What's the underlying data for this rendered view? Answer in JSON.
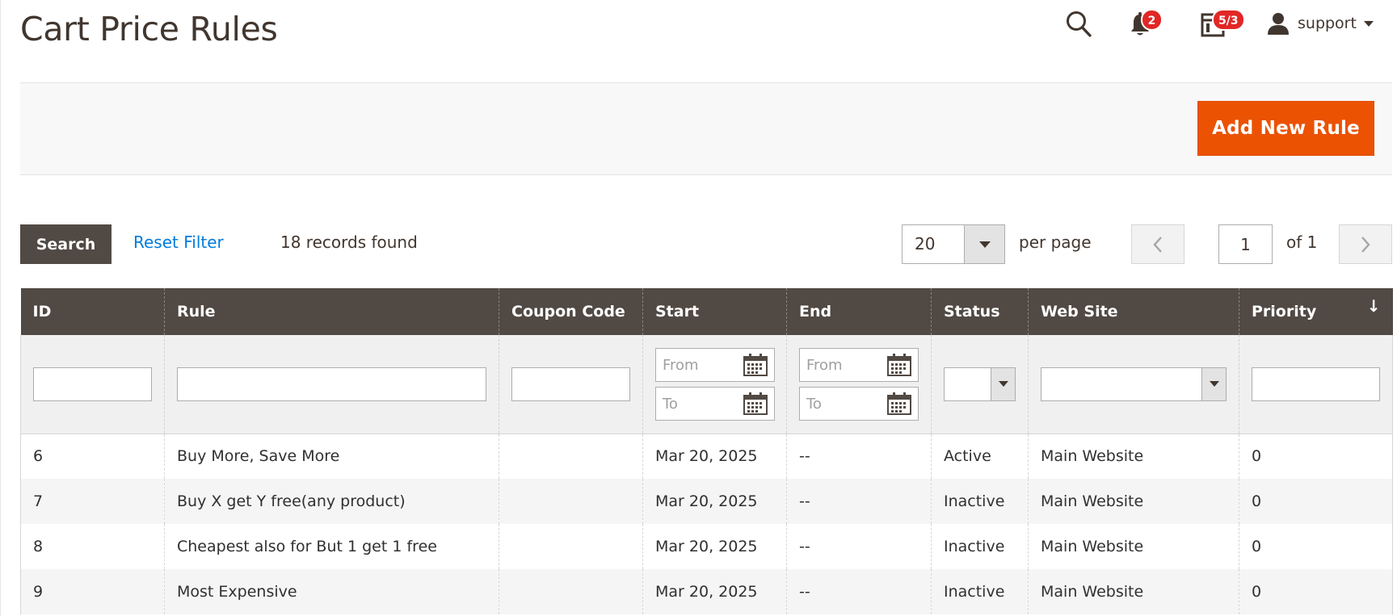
{
  "header": {
    "title": "Cart Price Rules",
    "notifications_count": "2",
    "system_messages_count": "5/3",
    "user_name": "support"
  },
  "actions": {
    "add_new_rule": "Add New Rule"
  },
  "toolbar": {
    "search_label": "Search",
    "reset_filter_label": "Reset Filter",
    "records_found": "18 records found",
    "per_page_value": "20",
    "per_page_label": "per page",
    "current_page": "1",
    "of_pages": "of 1"
  },
  "table": {
    "columns": [
      "ID",
      "Rule",
      "Coupon Code",
      "Start",
      "End",
      "Status",
      "Web Site",
      "Priority"
    ],
    "sort_indicator": "↓",
    "filters": {
      "from_placeholder": "From",
      "to_placeholder": "To"
    },
    "rows": [
      [
        "6",
        "Buy More, Save More",
        "",
        "Mar 20, 2025",
        "--",
        "Active",
        "Main Website",
        "0"
      ],
      [
        "7",
        "Buy X get Y free(any product)",
        "",
        "Mar 20, 2025",
        "--",
        "Inactive",
        "Main Website",
        "0"
      ],
      [
        "8",
        "Cheapest also for But 1 get 1 free",
        "",
        "Mar 20, 2025",
        "--",
        "Inactive",
        "Main Website",
        "0"
      ],
      [
        "9",
        "Most Expensive",
        "",
        "Mar 20, 2025",
        "--",
        "Inactive",
        "Main Website",
        "0"
      ]
    ]
  },
  "colors": {
    "accent": "#eb5202",
    "header_bg": "#514943",
    "link": "#007bdb",
    "badge": "#e22626"
  }
}
